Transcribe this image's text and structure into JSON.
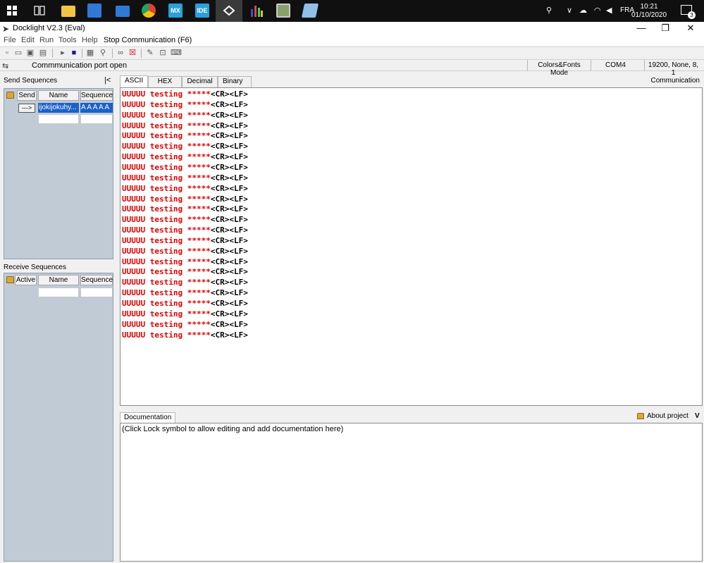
{
  "taskbar": {
    "language": "FRA",
    "time": "10:21",
    "date": "01/10/2020",
    "notification_count": "3",
    "apps": [
      {
        "icon": "windows-start-icon",
        "color": "#ffffff"
      },
      {
        "icon": "task-view-icon",
        "color": "#ffffff"
      },
      {
        "icon": "file-explorer-icon",
        "color": "#f4c542"
      },
      {
        "icon": "store-icon",
        "color": "#2f7ad6"
      },
      {
        "icon": "mail-icon",
        "color": "#2f7ad6"
      },
      {
        "icon": "chrome-icon",
        "color": "#e34133"
      },
      {
        "icon": "mx-icon",
        "color": "#2aa0dc"
      },
      {
        "icon": "ide-icon",
        "color": "#2aa0dc"
      },
      {
        "icon": "docklight-icon",
        "color": "#ffffff"
      },
      {
        "icon": "chart-app-icon",
        "color": "#4a4ad0"
      },
      {
        "icon": "monitor-app-icon",
        "color": "#8aa06a"
      },
      {
        "icon": "notes-app-icon",
        "color": "#8fc0e8"
      }
    ],
    "mx_label": "MX",
    "ide_label": "IDE"
  },
  "window": {
    "title": "Docklight V2.3 (Eval)",
    "minimize": "—",
    "maximize": "❐",
    "close": "✕"
  },
  "menu": {
    "file": "File",
    "edit": "Edit",
    "run": "Run",
    "tools": "Tools",
    "help": "Help",
    "stop_communication": "Stop Communication  (F6)"
  },
  "status": {
    "port_status": "Commmunication port open",
    "colors_fonts_mode": "Colors&Fonts Mode",
    "port": "COM4",
    "settings": "19200, None, 8, 1"
  },
  "send_sequences": {
    "label": "Send Sequences",
    "collapse": "|<",
    "columns": {
      "send": "Send",
      "name": "Name",
      "sequence": "Sequence"
    },
    "rows": [
      {
        "button": "--->",
        "name": "ijokijokuhy...",
        "sequence": "A A A A A"
      }
    ]
  },
  "receive_sequences": {
    "label": "Receive Sequences",
    "columns": {
      "active": "Active",
      "name": "Name",
      "sequence": "Sequence"
    }
  },
  "tabs": {
    "ascii": "ASCII",
    "hex": "HEX",
    "decimal": "Decimal",
    "binary": "Binary",
    "section_label": "Communication"
  },
  "communication": {
    "data": "UUUUU testing *****",
    "control": "<CR><LF>",
    "data_color": "#e00000",
    "line_count": 24
  },
  "documentation": {
    "tab": "Documentation",
    "about": "About project",
    "expand": "V",
    "placeholder": "(Click Lock symbol to allow editing and add documentation here)"
  }
}
